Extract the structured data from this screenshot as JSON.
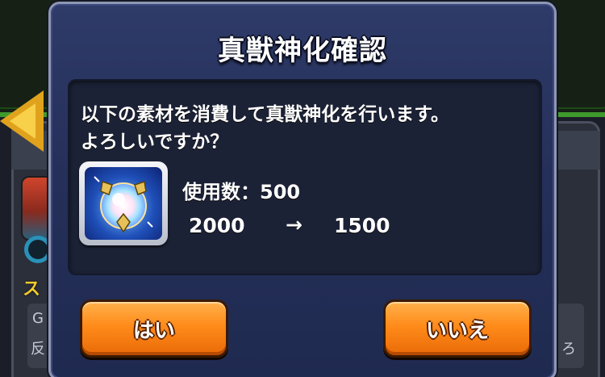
{
  "background": {
    "visible_text": {
      "partial_char_1": "ス",
      "partial_char_2": "G",
      "partial_char_3": "反",
      "partial_char_4": "ろ"
    }
  },
  "dialog": {
    "title": "真獣神化確認",
    "message_line1": "以下の素材を消費して真獣神化を行います。",
    "message_line2": "よろしいですか？",
    "item": {
      "icon": "crystal-orb-icon",
      "usage_label": "使用数：500",
      "count_from": "2000",
      "count_arrow": "→",
      "count_to": "1500"
    },
    "buttons": {
      "yes_label": "はい",
      "no_label": "いいえ"
    }
  },
  "colors": {
    "dialog_bg": "#25305a",
    "button_orange": "#ff8b1a",
    "text": "#ffffff"
  }
}
